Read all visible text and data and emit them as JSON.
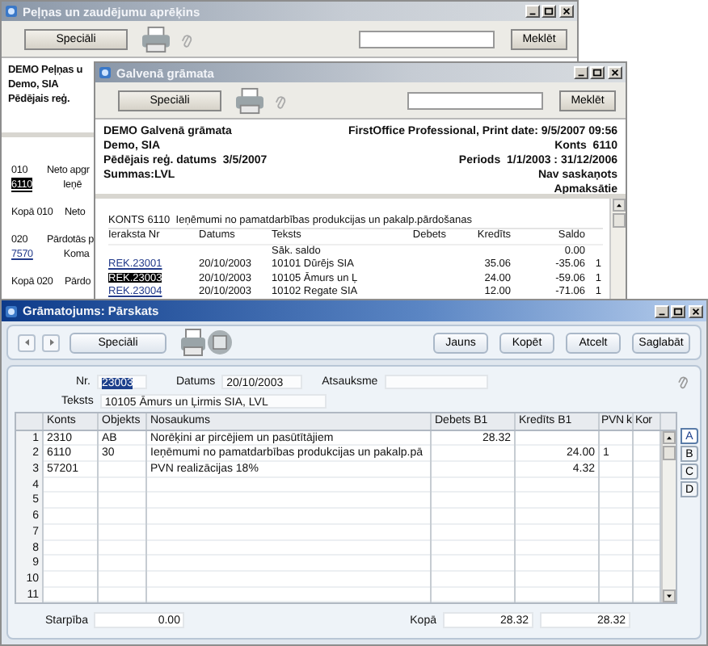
{
  "profit_loss_window": {
    "title": "Peļņas un zaudējumu aprēķins",
    "special_button": "Speciāli",
    "search_button": "Meklēt",
    "header_lines": [
      "DEMO Peļņas u",
      "Demo, SIA",
      "Pēdējais reģ."
    ],
    "rows": [
      {
        "kind": "heading",
        "code": "010",
        "text": "Neto apgr"
      },
      {
        "kind": "account",
        "code": "6110",
        "text": "Ieņē",
        "selected": true
      },
      {
        "kind": "total",
        "code": "Kopā 010",
        "text": "Neto"
      },
      {
        "kind": "heading",
        "code": "020",
        "text": "Pārdotās p"
      },
      {
        "kind": "account",
        "code": "7570",
        "text": "Koma",
        "selected": false
      },
      {
        "kind": "total",
        "code": "Kopā 020",
        "text": "Pārdo"
      }
    ]
  },
  "general_ledger_window": {
    "title": "Galvenā grāmata",
    "special_button": "Speciāli",
    "search_button": "Meklēt",
    "header_left": [
      "DEMO Galvenā grāmata",
      "Demo, SIA",
      "Pēdējais reģ. datums  3/5/2007",
      "Summas:LVL"
    ],
    "header_right": [
      "FirstOffice Professional, Print date: 9/5/2007 09:56",
      "Konts  6110",
      "Periods  1/1/2003 : 31/12/2006",
      "Nav saskaņots",
      "Apmaksātie"
    ],
    "account_title": "KONTS 6110  Ieņēmumi no pamatdarbības produkcijas un pakalp.pārdošanas",
    "columns": [
      "Ieraksta Nr",
      "Datums",
      "Teksts",
      "Debets",
      "Kredīts",
      "Saldo"
    ],
    "rows": [
      {
        "kind": "opening",
        "text": "Sāk. saldo",
        "balance": "0.00"
      },
      {
        "kind": "entry",
        "entry": "REK.23001",
        "date": "20/10/2003",
        "text": "10101 Dūrējs SIA",
        "credit": "35.06",
        "balance": "-35.06",
        "flag": "1",
        "selected": false
      },
      {
        "kind": "entry",
        "entry": "REK.23003",
        "date": "20/10/2003",
        "text": "10105 Āmurs un Ļ",
        "credit": "24.00",
        "balance": "-59.06",
        "flag": "1",
        "selected": true
      },
      {
        "kind": "entry",
        "entry": "REK.23004",
        "date": "20/10/2003",
        "text": "10102 Regate SIA",
        "credit": "12.00",
        "balance": "-71.06",
        "flag": "1",
        "selected": false
      }
    ]
  },
  "entry_window": {
    "title": "Grāmatojums: Pārskats",
    "special_button": "Speciāli",
    "action_buttons": [
      "Jauns",
      "Kopēt",
      "Atcelt",
      "Saglabāt"
    ],
    "fields": {
      "nr": {
        "label": "Nr.",
        "value": "23003",
        "highlighted": true
      },
      "date": {
        "label": "Datums",
        "value": "20/10/2003"
      },
      "reference": {
        "label": "Atsauksme"
      },
      "text": {
        "label": "Teksts",
        "value": "10105 Āmurs un Ļirmis SIA, LVL"
      }
    },
    "columns": [
      "Konts",
      "Objekts",
      "Nosaukums",
      "Debets B1",
      "Kredīts B1",
      "PVN k",
      "Kor"
    ],
    "rows": [
      {
        "number": "1",
        "account": "2310",
        "object": "AB",
        "name": "Norēķini ar pircējiem un pasūtītājiem",
        "debit": "28.32"
      },
      {
        "number": "2",
        "account": "6110",
        "object": "30",
        "name": "Ieņēmumi no pamatdarbības produkcijas un pakalp.pā",
        "credit": "24.00",
        "vat": "1"
      },
      {
        "number": "3",
        "account": "57201",
        "name": "PVN realizācijas 18%",
        "credit": "4.32"
      },
      {
        "number": "4"
      },
      {
        "number": "5"
      },
      {
        "number": "6"
      },
      {
        "number": "7"
      },
      {
        "number": "8"
      },
      {
        "number": "9"
      },
      {
        "number": "10"
      },
      {
        "number": "11"
      }
    ],
    "side_tabs": [
      {
        "label": "A",
        "selected": true
      },
      {
        "label": "B",
        "selected": false
      },
      {
        "label": "C",
        "selected": false
      },
      {
        "label": "D",
        "selected": false
      }
    ],
    "footer": {
      "difference_label": "Starpība",
      "difference": "0.00",
      "total_label": "Kopā",
      "debit_total": "28.32",
      "credit_total": "28.32"
    }
  }
}
